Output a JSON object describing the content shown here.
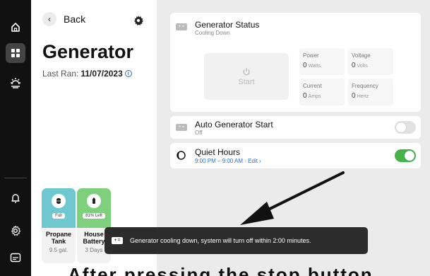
{
  "sidebar": {
    "items": [
      {
        "name": "home",
        "icon": "home-icon"
      },
      {
        "name": "dashboard",
        "icon": "grid-icon",
        "active": true
      },
      {
        "name": "lighting",
        "icon": "sun-icon"
      },
      {
        "name": "alerts",
        "icon": "bell-icon"
      },
      {
        "name": "settings",
        "icon": "gear-icon"
      },
      {
        "name": "display",
        "icon": "screen-icon"
      }
    ]
  },
  "header": {
    "back_label": "Back",
    "title": "Generator",
    "last_ran_label": "Last Ran:",
    "last_ran_value": "11/07/2023",
    "info_glyph": "i"
  },
  "cards": [
    {
      "label_line1": "Propane",
      "label_line2": "Tank",
      "pill": "Full",
      "sub": "9.5 gal.",
      "color": "#6fc8cf"
    },
    {
      "label_line1": "House",
      "label_line2": "Battery",
      "pill": "81% Left",
      "sub": "3 Days",
      "color": "#7ed07d"
    }
  ],
  "generator_status": {
    "icon_glyph": "+ =",
    "title": "Generator Status",
    "subtitle": "Cooling Down",
    "start_label": "Start",
    "metrics": [
      {
        "label": "Power",
        "value": "0",
        "unit": "Watts"
      },
      {
        "label": "Voltage",
        "value": "0",
        "unit": "Volts"
      },
      {
        "label": "Current",
        "value": "0",
        "unit": "Amps"
      },
      {
        "label": "Frequency",
        "value": "0",
        "unit": "Hertz"
      }
    ]
  },
  "auto_start": {
    "icon_glyph": "+ =",
    "title": "Auto Generator Start",
    "subtitle": "Off",
    "enabled": false
  },
  "quiet_hours": {
    "title": "Quiet Hours",
    "schedule": "9:00 PM – 9:00 AM · Edit ›",
    "enabled": true,
    "accent": "#46b34a"
  },
  "toast": {
    "icon_glyph": "+ =",
    "message": "Generator cooling down, system will turn off within 2:00 minutes."
  },
  "bottom_caption": "After pressing the stop button"
}
